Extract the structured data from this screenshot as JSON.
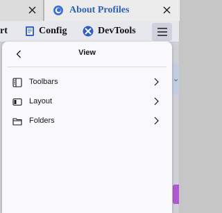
{
  "tabs": {
    "inactive_close": "×",
    "active_title": "About Profiles",
    "active_close": "×"
  },
  "toolbar": {
    "partial_label": "rt",
    "config_label": "Config",
    "devtools_label": "DevTools"
  },
  "panel": {
    "title": "View",
    "items": [
      {
        "label": "Toolbars",
        "icon": "toolbars-icon"
      },
      {
        "label": "Layout",
        "icon": "layout-icon"
      },
      {
        "label": "Folders",
        "icon": "folder-icon"
      }
    ]
  },
  "colors": {
    "accent": "#2d5fb3",
    "panel_bg": "#f9f9fb",
    "purple_strip": "#b259d1"
  }
}
